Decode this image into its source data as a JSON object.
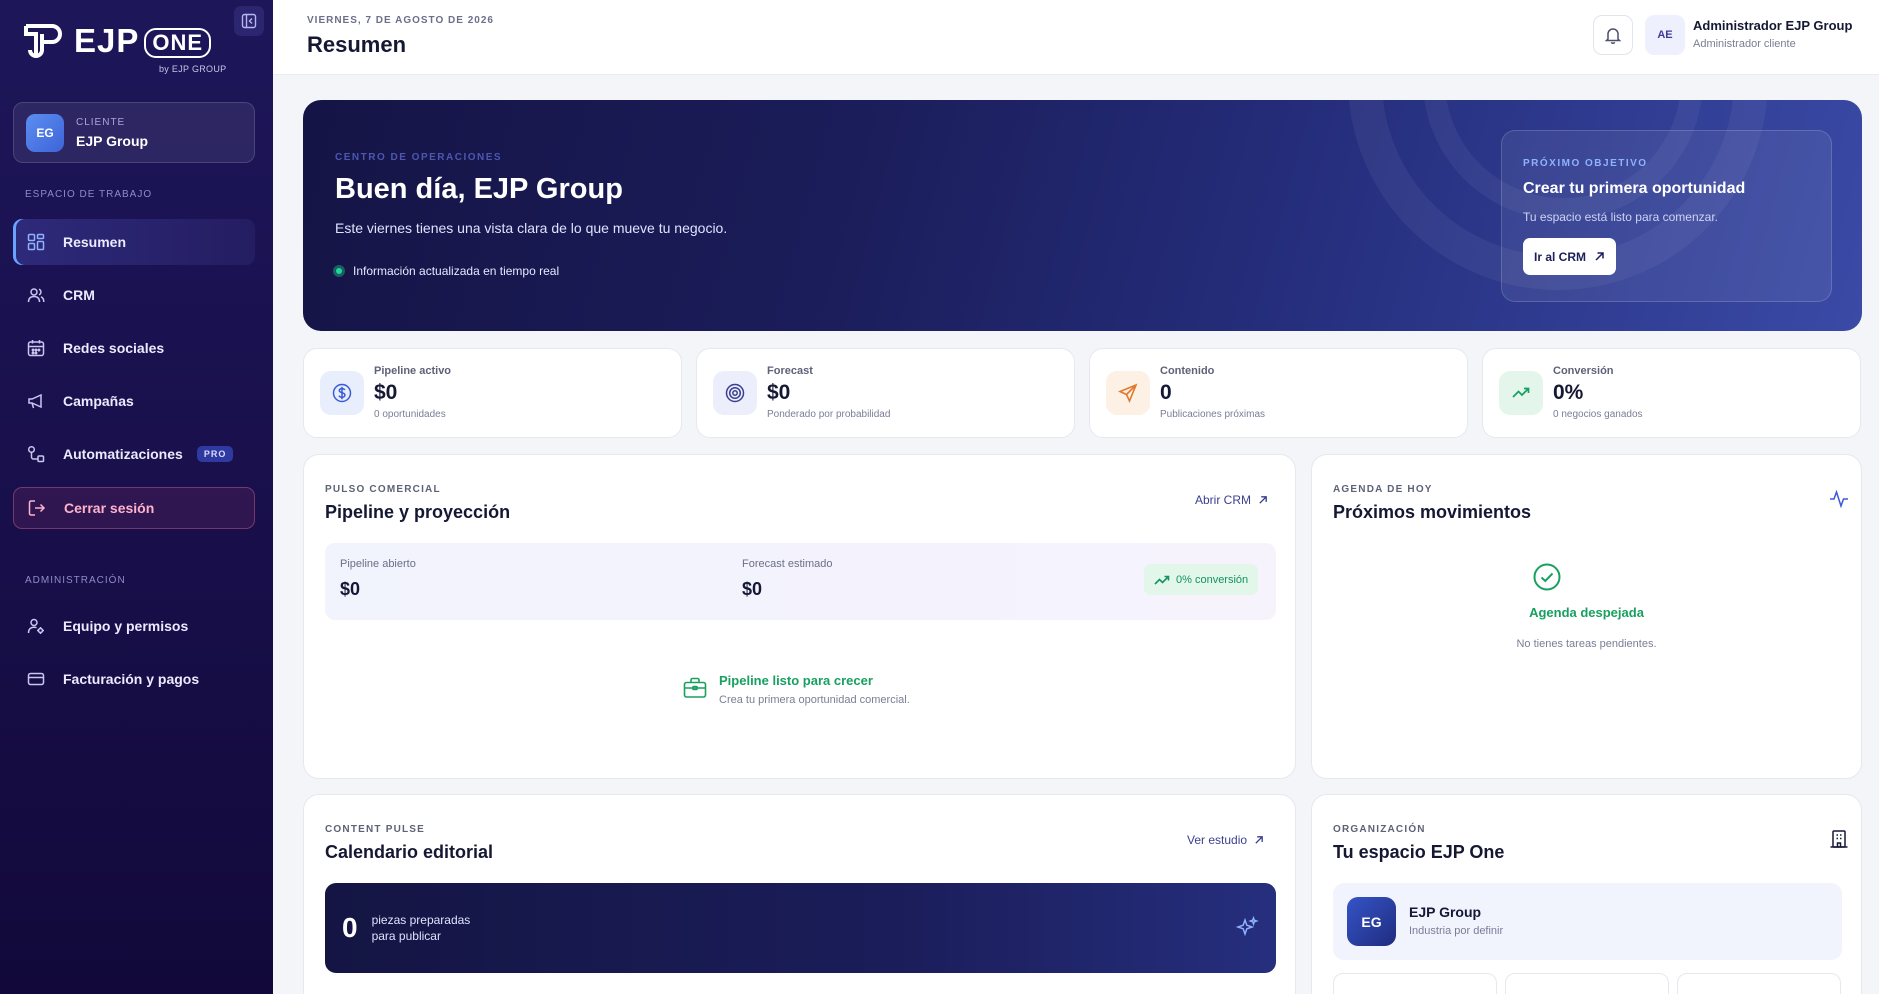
{
  "brand": {
    "name": "EJP",
    "suffix": "ONE",
    "byline": "by EJP GROUP"
  },
  "client": {
    "label": "CLIENTE",
    "initials": "EG",
    "name": "EJP Group"
  },
  "sidebar": {
    "workspace_label": "ESPACIO DE TRABAJO",
    "items": [
      {
        "label": "Resumen",
        "icon": "grid-icon",
        "active": true
      },
      {
        "label": "CRM",
        "icon": "users-icon"
      },
      {
        "label": "Redes sociales",
        "icon": "calendar-icon"
      },
      {
        "label": "Campañas",
        "icon": "megaphone-icon"
      },
      {
        "label": "Automatizaciones",
        "icon": "workflow-icon",
        "badge": "PRO"
      }
    ],
    "logout": "Cerrar sesión",
    "admin_label": "ADMINISTRACIÓN",
    "admin_items": [
      {
        "label": "Equipo y permisos",
        "icon": "user-cog-icon"
      },
      {
        "label": "Facturación y pagos",
        "icon": "credit-card-icon"
      }
    ]
  },
  "header": {
    "date": "VIERNES, 7 DE AGOSTO DE 2026",
    "title": "Resumen",
    "user_initials": "AE",
    "user_name": "Administrador EJP Group",
    "user_role": "Administrador cliente"
  },
  "hero": {
    "eyebrow": "CENTRO DE OPERACIONES",
    "title": "Buen día, EJP Group",
    "subtitle": "Este viernes tienes una vista clara de lo que mueve tu negocio.",
    "live_text": "Información actualizada en tiempo real",
    "next": {
      "eyebrow": "PRÓXIMO OBJETIVO",
      "title": "Crear tu primera oportunidad",
      "subtitle": "Tu espacio está listo para comenzar.",
      "button": "Ir al CRM"
    }
  },
  "stats": [
    {
      "label": "Pipeline activo",
      "value": "$0",
      "sub": "0 oportunidades",
      "icon": "dollar-icon",
      "color": "#3b5bd6"
    },
    {
      "label": "Forecast",
      "value": "$0",
      "sub": "Ponderado por probabilidad",
      "icon": "target-icon",
      "color": "#3b3f8e"
    },
    {
      "label": "Contenido",
      "value": "0",
      "sub": "Publicaciones próximas",
      "icon": "send-icon",
      "color": "#e0792b"
    },
    {
      "label": "Conversión",
      "value": "0%",
      "sub": "0 negocios ganados",
      "icon": "trending-up-icon",
      "color": "#18a060"
    }
  ],
  "pipeline": {
    "eyebrow": "PULSO COMERCIAL",
    "title": "Pipeline y proyección",
    "link": "Abrir CRM",
    "open_label": "Pipeline abierto",
    "open_value": "$0",
    "forecast_label": "Forecast estimado",
    "forecast_value": "$0",
    "conversion_badge": "0% conversión",
    "empty_title": "Pipeline listo para crecer",
    "empty_sub": "Crea tu primera oportunidad comercial."
  },
  "agenda": {
    "eyebrow": "AGENDA DE HOY",
    "title": "Próximos movimientos",
    "empty_title": "Agenda despejada",
    "empty_sub": "No tienes tareas pendientes."
  },
  "editorial": {
    "eyebrow": "CONTENT PULSE",
    "title": "Calendario editorial",
    "link": "Ver estudio",
    "count": "0",
    "count_label": "piezas preparadas para publicar"
  },
  "organization": {
    "eyebrow": "ORGANIZACIÓN",
    "title": "Tu espacio EJP One",
    "initials": "EG",
    "name": "EJP Group",
    "industry": "Industria por definir"
  }
}
